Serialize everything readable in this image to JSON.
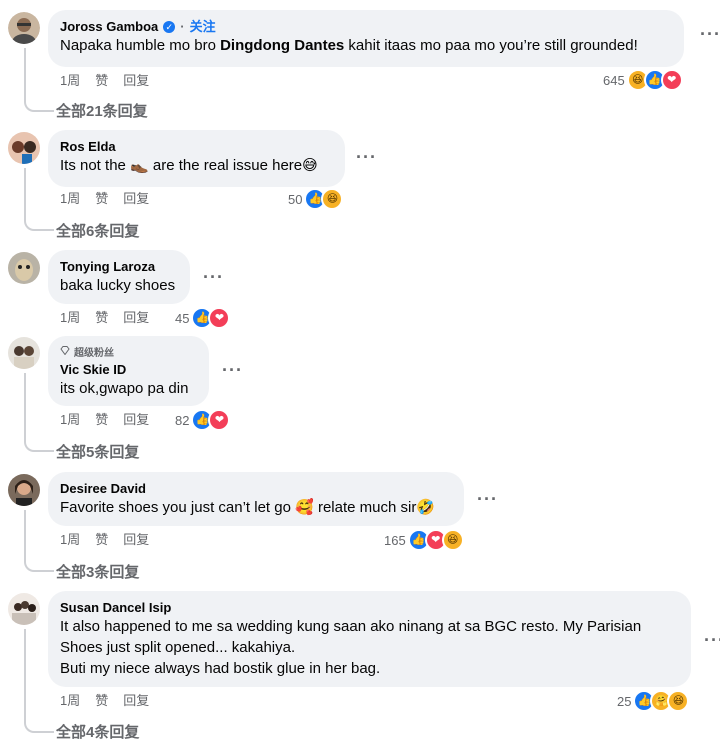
{
  "comments": [
    {
      "author": "Joross Gamboa",
      "verified_mark": "✓",
      "follow": "关注",
      "text_pre": "Napaka humble mo bro ",
      "mention": "Dingdong Dantes",
      "text_post": " kahit itaas mo paa mo you’re still grounded!",
      "time": "1周",
      "like": "赞",
      "reply": "回复",
      "reaction_count": "645",
      "reactions": [
        "haha-icon",
        "like-icon",
        "love-icon"
      ],
      "view_replies": "全部21条回复"
    },
    {
      "author": "Ros Elda",
      "text": "Its not the 👞 are the real issue here😅",
      "time": "1周",
      "like": "赞",
      "reply": "回复",
      "reaction_count": "50",
      "reactions": [
        "like-icon",
        "haha-icon"
      ],
      "view_replies": "全部6条回复"
    },
    {
      "author": "Tonying Laroza",
      "text": "baka lucky shoes",
      "time": "1周",
      "like": "赞",
      "reply": "回复",
      "reaction_count": "45",
      "reactions": [
        "like-icon",
        "love-icon"
      ]
    },
    {
      "badge": "超级粉丝",
      "author": "Vic Skie ID",
      "text": "its ok,gwapo pa din",
      "time": "1周",
      "like": "赞",
      "reply": "回复",
      "reaction_count": "82",
      "reactions": [
        "like-icon",
        "love-icon"
      ],
      "view_replies": "全部5条回复"
    },
    {
      "author": "Desiree David",
      "text": "Favorite shoes you just can’t let go 🥰 relate much sir🤣",
      "time": "1周",
      "like": "赞",
      "reply": "回复",
      "reaction_count": "165",
      "reactions": [
        "like-icon",
        "love-icon",
        "haha-icon"
      ],
      "view_replies": "全部3条回复"
    },
    {
      "author": "Susan Dancel Isip",
      "text": "It also happened to me sa wedding kung saan ako ninang at sa BGC resto. My Parisian\nShoes just split opened... kakahiya.\nButi my niece always had bostik glue in her bag.",
      "time": "1周",
      "like": "赞",
      "reply": "回复",
      "reaction_count": "25",
      "reactions": [
        "like-icon",
        "care-icon",
        "haha-icon"
      ],
      "view_replies": "全部4条回复"
    }
  ],
  "more_glyph": "···",
  "reaction_glyphs": {
    "like": "👍",
    "love": "❤",
    "haha": "😆",
    "care": "🤗"
  },
  "colors": {
    "accent": "#1877f2",
    "bubble": "#f0f2f5",
    "muted": "#65676b",
    "love": "#f33e58",
    "haha": "#f7b125"
  }
}
